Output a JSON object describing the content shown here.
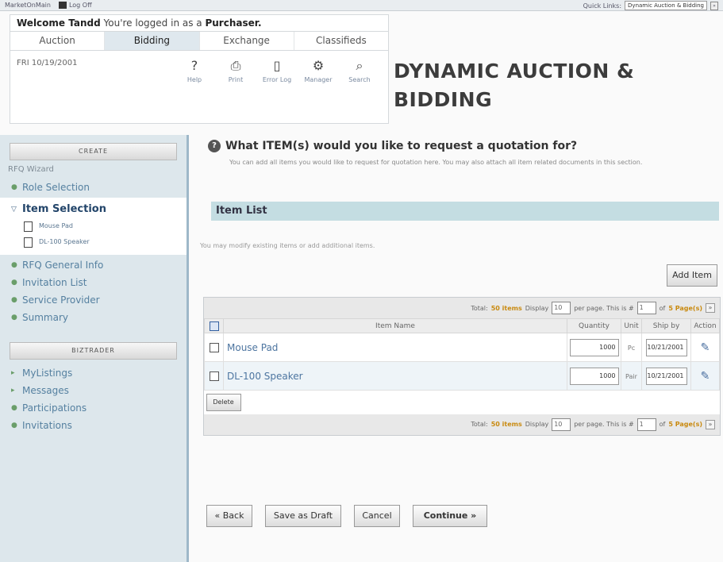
{
  "topbar": {
    "left_text": "MarketOnMain",
    "logoff": "Log Off",
    "quick_links_label": "Quick Links:",
    "quick_links_value": "Dynamic Auction & Bidding"
  },
  "welcome": {
    "greeting": "Welcome Tandd",
    "status": "You're logged in as a ",
    "role": "Purchaser."
  },
  "tabs": [
    "Auction",
    "Bidding",
    "Exchange",
    "Classifieds"
  ],
  "date": "FRI 10/19/2001",
  "tools": [
    {
      "icon": "?",
      "label": "Help"
    },
    {
      "icon": "⎙",
      "label": "Print"
    },
    {
      "icon": "▯",
      "label": "Error Log"
    },
    {
      "icon": "⚙",
      "label": "Manager"
    },
    {
      "icon": "⌕",
      "label": "Search"
    }
  ],
  "page_heading": "DYNAMIC AUCTION & BIDDING",
  "sidebar": {
    "create_header": "CREATE",
    "rfq_label": "RFQ Wizard",
    "items": [
      {
        "label": "Role Selection"
      },
      {
        "label": "Item Selection"
      },
      {
        "label": "RFQ General Info"
      },
      {
        "label": "Invitation List"
      },
      {
        "label": "Service Provider"
      },
      {
        "label": "Summary"
      }
    ],
    "subitems": [
      "Mouse Pad",
      "DL-100 Speaker"
    ],
    "biztrader_header": "BIZTRADER",
    "biz_items": [
      "MyListings",
      "Messages",
      "Participations",
      "Invitations"
    ]
  },
  "main": {
    "question": "What ITEM(s) would you like to request a quotation for?",
    "description": "You can add all items you would like to request for quotation here. You may also attach all item related documents in this section.",
    "section_title": "Item List",
    "modify_note": "You may modify existing items or add additional items.",
    "add_item": "Add Item",
    "pager": {
      "total_label": "Total:",
      "total_value": "50 items",
      "display_label": "Display",
      "per_page": "10",
      "per_page_label": "per page. This is #",
      "page_no": "1",
      "of_label": "of",
      "pages": "5 Page(s)"
    },
    "columns": [
      "Item Name",
      "Quantity",
      "Unit",
      "Ship by",
      "Action"
    ],
    "rows": [
      {
        "name": "Mouse Pad",
        "qty": "1000",
        "unit": "Pc",
        "ship": "10/21/2001"
      },
      {
        "name": "DL-100 Speaker",
        "qty": "1000",
        "unit": "Pair",
        "ship": "10/21/2001"
      }
    ],
    "delete": "Delete",
    "buttons": {
      "back": "« Back",
      "save_draft": "Save as Draft",
      "cancel": "Cancel",
      "continue": "Continue »"
    }
  }
}
